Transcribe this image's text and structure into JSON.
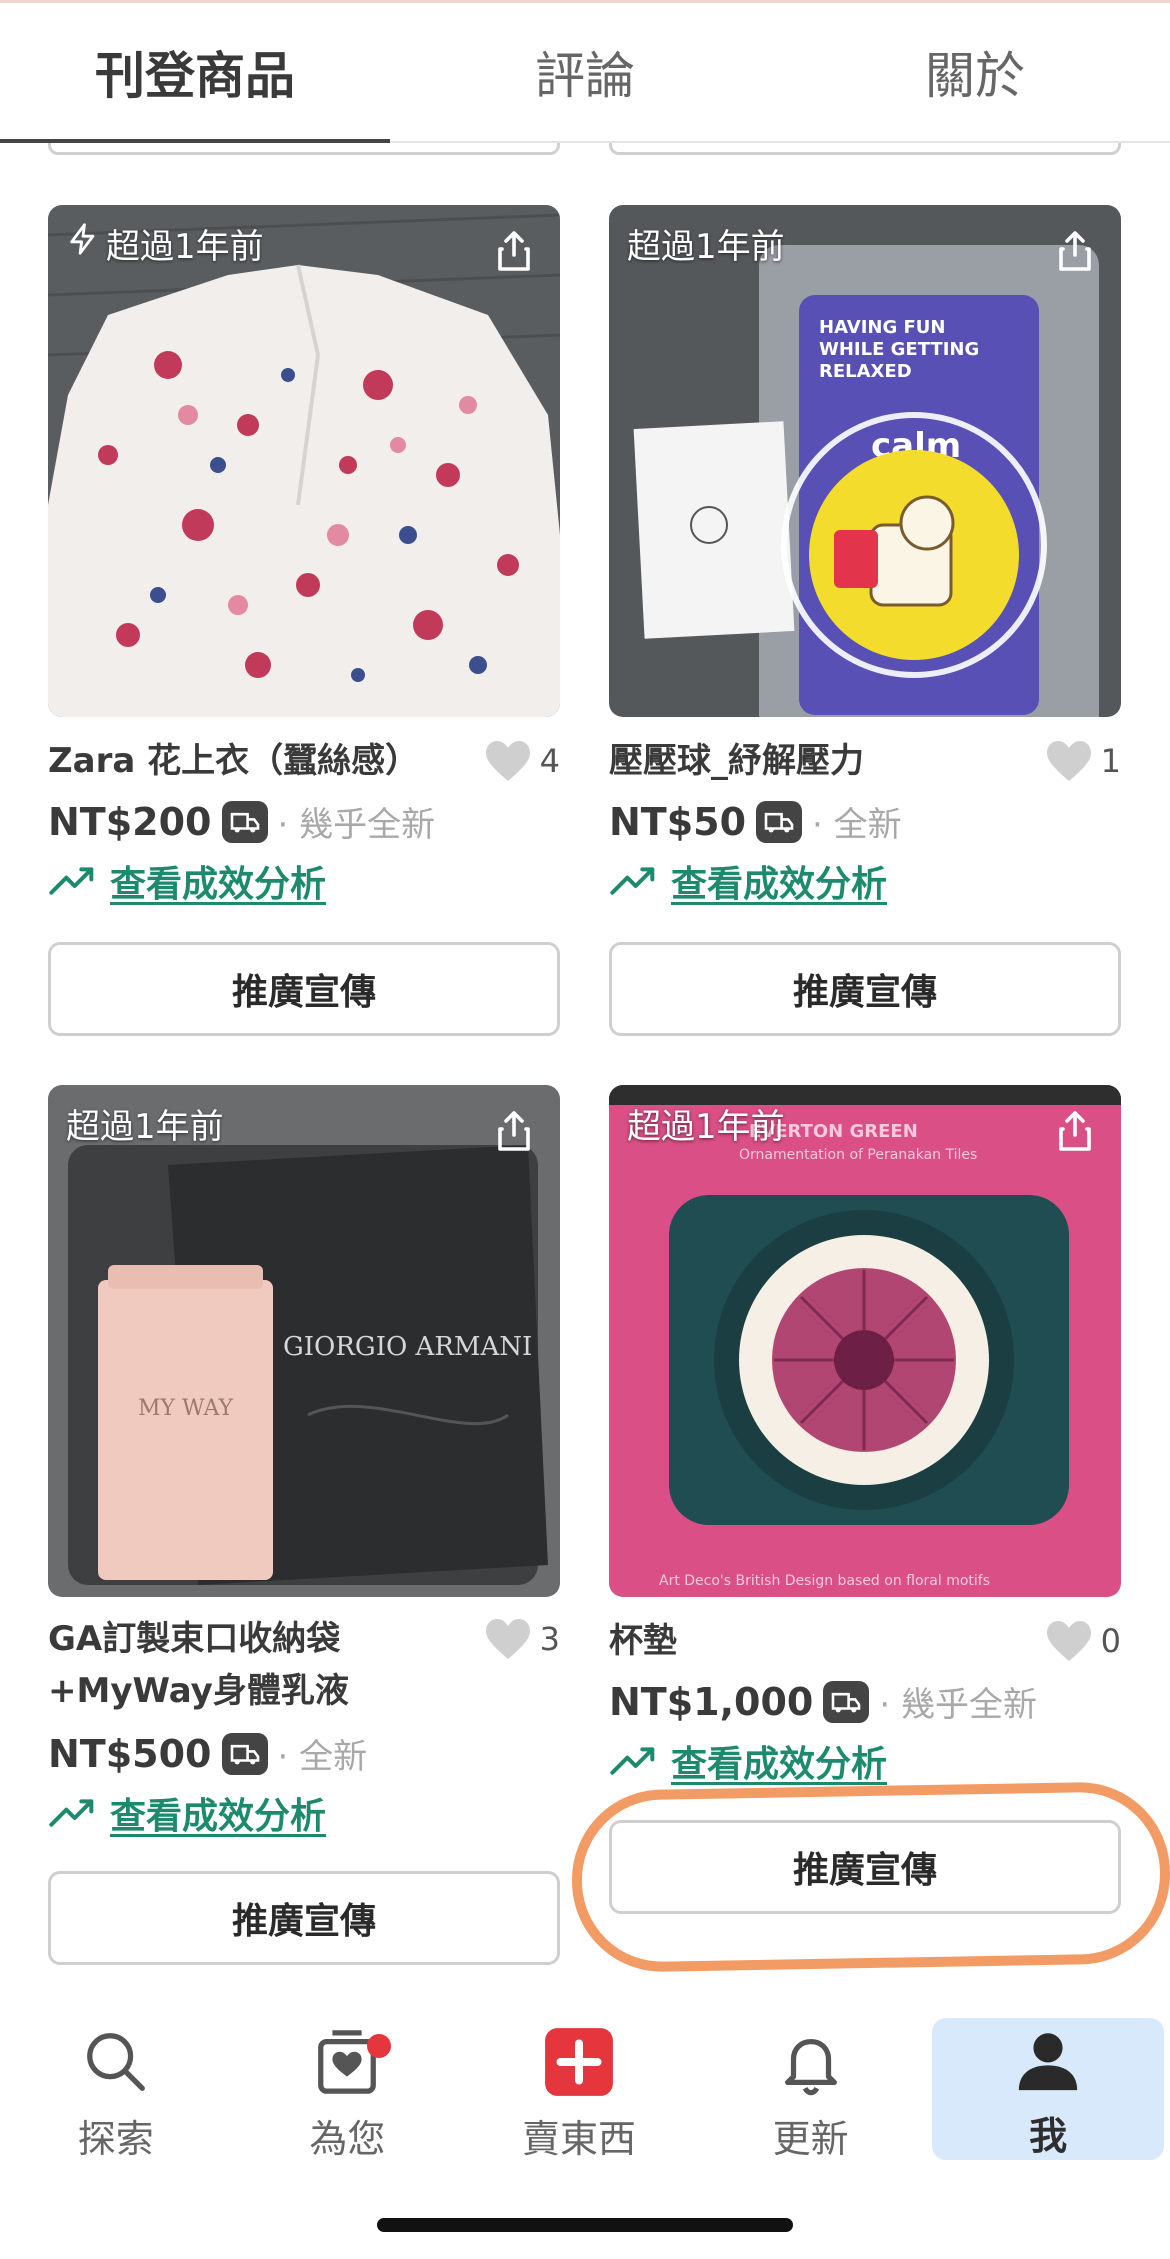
{
  "tabs": [
    {
      "label": "刊登商品",
      "active": true
    },
    {
      "label": "評論",
      "active": false
    },
    {
      "label": "關於",
      "active": false
    }
  ],
  "listings": [
    {
      "age": "超過1年前",
      "title": "Zara 花上衣（蠶絲感）",
      "likes": "4",
      "price": "NT$200",
      "condition": "· 幾乎全新",
      "insight": "查看成效分析",
      "promote": "推廣宣傳"
    },
    {
      "age": "超過1年前",
      "title": "壓壓球_紓解壓力",
      "likes": "1",
      "price": "NT$50",
      "condition": "· 全新",
      "insight": "查看成效分析",
      "promote": "推廣宣傳",
      "photo_text": [
        "HAVING FUN",
        "WHILE GETTING",
        "RELAXED",
        "calm"
      ]
    },
    {
      "age": "超過1年前",
      "title_line1": "GA訂製束口收納袋",
      "title_line2": "+MyWay身體乳液",
      "likes": "3",
      "price": "NT$500",
      "condition": "· 全新",
      "insight": "查看成效分析",
      "promote": "推廣宣傳",
      "photo_text": [
        "MY WAY",
        "GIORGIO ARMANI"
      ]
    },
    {
      "age": "超過1年前",
      "title": "杯墊",
      "likes": "0",
      "price": "NT$1,000",
      "condition": "· 幾乎全新",
      "insight": "查看成效分析",
      "promote": "推廣宣傳",
      "photo_text": [
        "EVERTON GREEN",
        "Ornamentation of Peranakan Tiles",
        "Art Deco's British Design based on floral motifs"
      ]
    }
  ],
  "nav": [
    {
      "label": "探索",
      "icon": "search-icon"
    },
    {
      "label": "為您",
      "icon": "for-you-icon"
    },
    {
      "label": "賣東西",
      "icon": "sell-plus-icon"
    },
    {
      "label": "更新",
      "icon": "bell-icon"
    },
    {
      "label": "我",
      "icon": "profile-icon",
      "active": true
    }
  ],
  "colors": {
    "accent_green": "#1d8a6e",
    "sell_red": "#e5353d",
    "active_nav_bg": "#d7e9fb",
    "highlight_orange": "#f0894a"
  }
}
